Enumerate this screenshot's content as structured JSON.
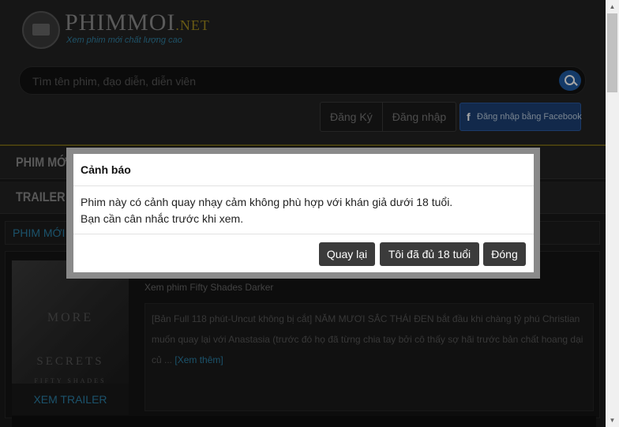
{
  "header": {
    "logo_text": "PHIMMOI",
    "logo_suffix": ".NET",
    "logo_tagline": "Xem phim mới chất lượng cao",
    "search_placeholder": "Tìm tên phim, đạo diễn, diễn viên",
    "register_label": "Đăng Ký",
    "login_label": "Đăng nhập",
    "facebook_icon": "f",
    "facebook_login_label": "Đăng nhập bằng Facebook"
  },
  "nav": {
    "items": [
      "PHIM MỚI",
      "TRAILER"
    ]
  },
  "section": {
    "title": "PHIM MỚI"
  },
  "movie": {
    "poster_lines": [
      "MORE",
      "SECRETS",
      "FIFTY SHADES"
    ],
    "trailer_button": "XEM TRAILER",
    "title": "Xem phim Fifty Shades Darker",
    "description": "[Bản Full 118 phút-Uncut không bị cắt] NĂM MƯƠI SẮC THÁI ĐEN bắt đầu khi chàng tỷ phú Christian muốn quay lại với Anastasia (trước đó họ đã từng chia tay bởi cô thấy sợ hãi trước bản chất hoang dại củ ...",
    "more_link": "[Xem thêm]"
  },
  "modal": {
    "title": "Cảnh báo",
    "message_line1": "Phim này có cảnh quay nhạy cảm không phù hợp với khán giả dưới 18 tuổi.",
    "message_line2": "Bạn cần cân nhắc trước khi xem.",
    "buttons": {
      "back": "Quay lại",
      "confirm_age": "Tôi đã đủ 18 tuổi",
      "close": "Đóng"
    }
  },
  "scrollbar": {
    "up_arrow": "▲",
    "down_arrow": "▼"
  }
}
